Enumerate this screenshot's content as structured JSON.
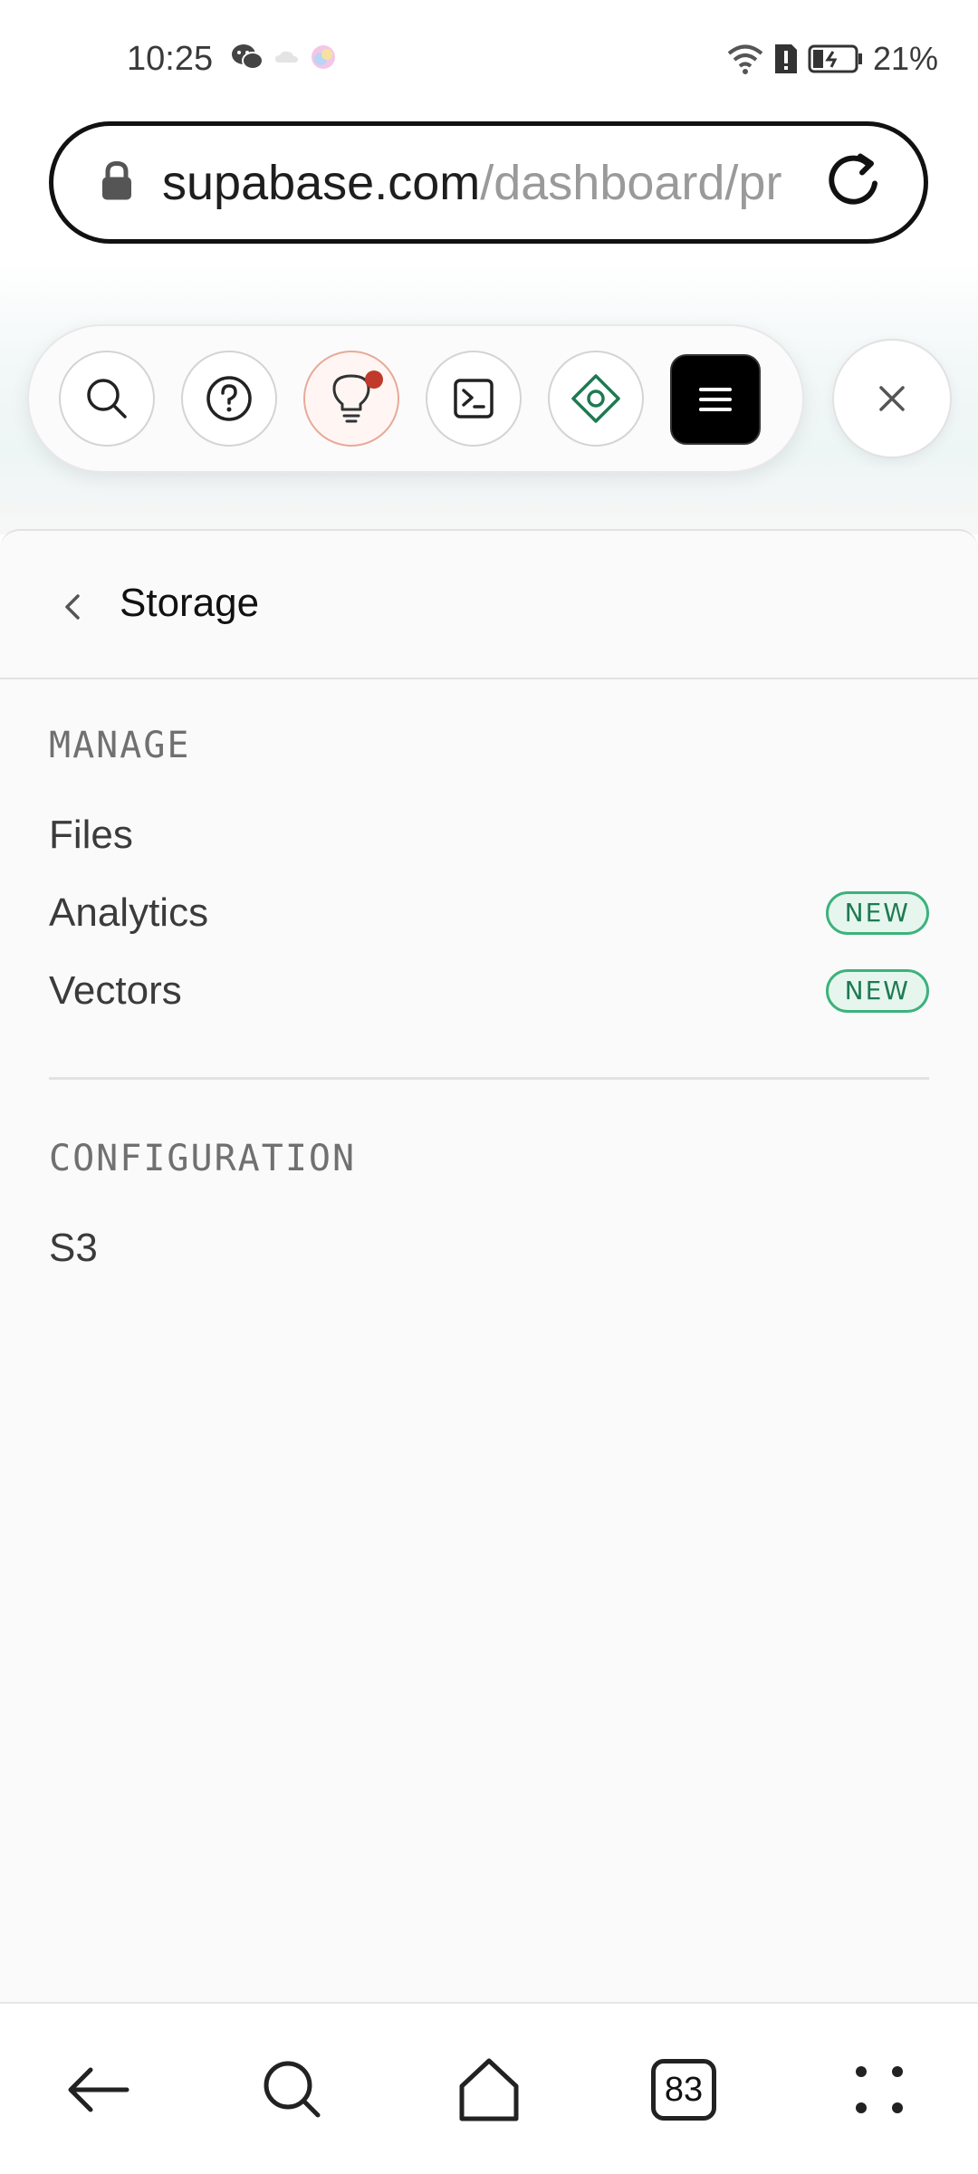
{
  "status_bar": {
    "time": "10:25",
    "battery": "21%"
  },
  "browser": {
    "url_host": "supabase.com",
    "url_path": "/dashboard/pr"
  },
  "toolbar": {
    "buttons": [
      "search-icon",
      "help-icon",
      "lightbulb-icon",
      "terminal-icon",
      "diamond-target-icon",
      "menu-icon"
    ],
    "close": "close-icon"
  },
  "panel": {
    "title": "Storage",
    "sections": [
      {
        "heading": "MANAGE",
        "items": [
          {
            "label": "Files",
            "badge": ""
          },
          {
            "label": "Analytics",
            "badge": "NEW"
          },
          {
            "label": "Vectors",
            "badge": "NEW"
          }
        ]
      },
      {
        "heading": "CONFIGURATION",
        "items": [
          {
            "label": "S3",
            "badge": ""
          }
        ]
      }
    ]
  },
  "bottom_nav": {
    "tabs_count": "83"
  },
  "colors": {
    "badge_green": "#3db27c",
    "notification_red": "#c0392b"
  }
}
